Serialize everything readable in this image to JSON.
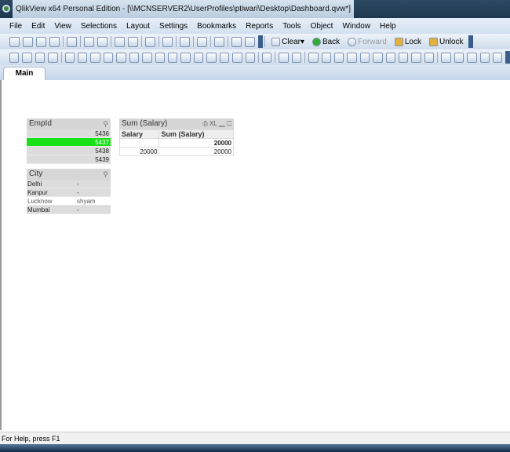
{
  "window": {
    "title": "QlikView x64 Personal Edition - [\\\\MCNSERVER2\\UserProfiles\\ptiwari\\Desktop\\Dashboard.qvw*]"
  },
  "menu": [
    "File",
    "Edit",
    "View",
    "Selections",
    "Layout",
    "Settings",
    "Bookmarks",
    "Reports",
    "Tools",
    "Object",
    "Window",
    "Help"
  ],
  "toolbar1": {
    "icons": [
      "new-icon",
      "open-icon",
      "reload-icon",
      "save-icon",
      "|",
      "print-icon",
      "|",
      "edit-script-icon",
      "reload-data-icon",
      "|",
      "undo-icon",
      "redo-icon",
      "|",
      "search-icon",
      "|",
      "select-fields-icon",
      "|",
      "chart-icon",
      "|",
      "favorite-icon",
      "|",
      "design-grid-icon",
      "|",
      "help-icon",
      "whats-this-icon"
    ],
    "clear": "Clear",
    "back": "Back",
    "forward": "Forward",
    "lock": "Lock",
    "unlock": "Unlock"
  },
  "toolbar2": {
    "icons": [
      "new-sheet-icon",
      "sheet-left-icon",
      "sheet-right-icon",
      "sheet-props-icon",
      "|",
      "listbox-icon",
      "statistics-box-icon",
      "multibox-icon",
      "table-box-icon",
      "chart-icon",
      "input-box-icon",
      "current-selections-icon",
      "button-icon",
      "text-object-icon",
      "line-arrow-icon",
      "slider-icon",
      "bookmark-object-icon",
      "search-object-icon",
      "container-icon",
      "custom-object-icon",
      "|",
      "server-objects-icon",
      "|",
      "format-painter-icon",
      "align-icon",
      "|",
      "align-left-icon",
      "align-center-icon",
      "align-right-icon",
      "align-bottom-icon",
      "align-middle-icon",
      "align-top-icon",
      "space-h-icon",
      "space-v-icon",
      "adjust-left-icon",
      "adjust-top-icon",
      "|",
      "user-icon",
      "document-props-icon",
      "sheet-props2-icon",
      "expression-icon",
      "table-viewer-icon"
    ]
  },
  "tabs": [
    {
      "label": "Main"
    }
  ],
  "empid": {
    "title": "EmpId",
    "values": [
      "5436",
      "5437",
      "5438",
      "5439"
    ],
    "selected": "5437"
  },
  "city": {
    "title": "City",
    "rows": [
      {
        "city": "Delhi",
        "val": "-"
      },
      {
        "city": "Kanpur",
        "val": "-"
      },
      {
        "city": "Lucknow",
        "val": "shyam",
        "possible": true
      },
      {
        "city": "Mumbai",
        "val": "-"
      }
    ]
  },
  "table": {
    "title": "Sum (Salary)",
    "xl": "XL",
    "columns": [
      "Salary",
      "Sum (Salary)"
    ],
    "total": "20000",
    "rows": [
      [
        "20000",
        "20000"
      ]
    ]
  },
  "status": "For Help, press F1"
}
